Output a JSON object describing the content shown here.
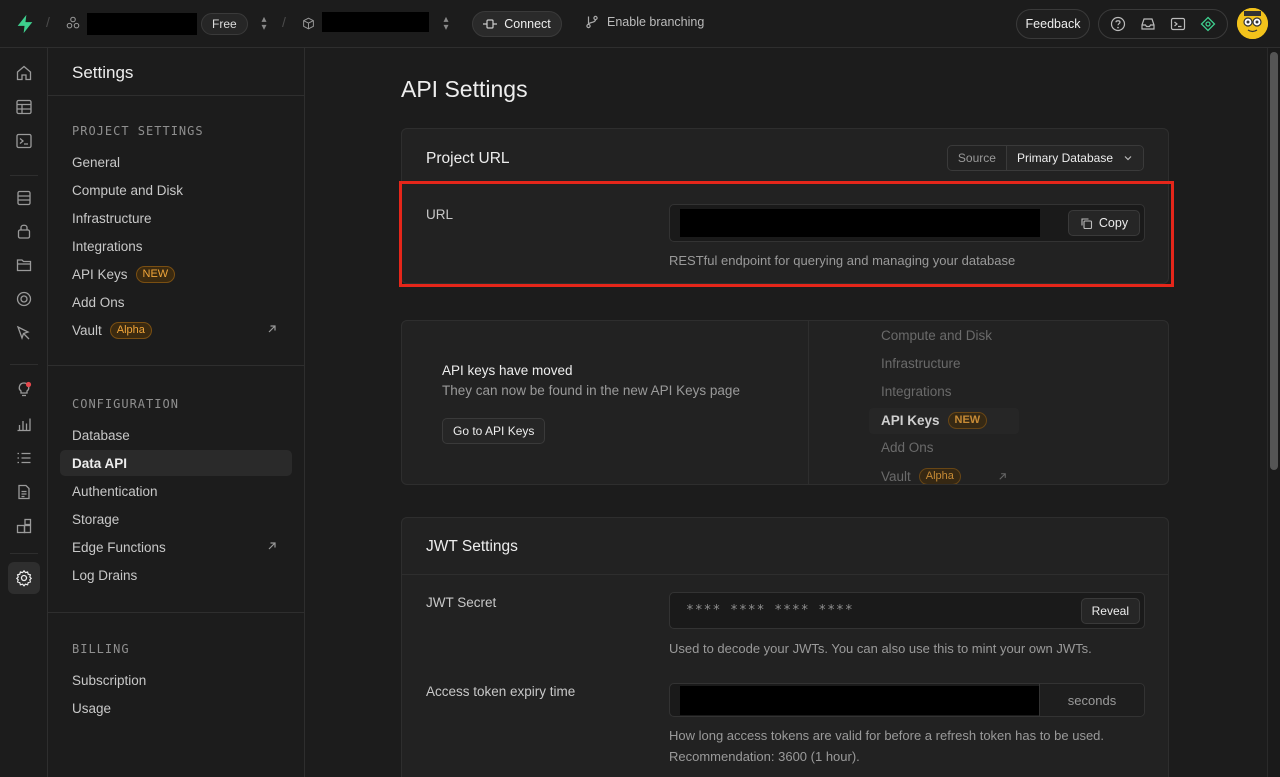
{
  "topbar": {
    "plan_badge": "Free",
    "connect_label": "Connect",
    "branching_label": "Enable branching",
    "feedback_label": "Feedback"
  },
  "sidebar": {
    "title": "Settings",
    "groups": [
      {
        "heading": "PROJECT SETTINGS",
        "items": [
          {
            "label": "General"
          },
          {
            "label": "Compute and Disk"
          },
          {
            "label": "Infrastructure"
          },
          {
            "label": "Integrations"
          },
          {
            "label": "API Keys",
            "badge": "NEW"
          },
          {
            "label": "Add Ons"
          },
          {
            "label": "Vault",
            "badge": "Alpha",
            "external": true
          }
        ]
      },
      {
        "heading": "CONFIGURATION",
        "items": [
          {
            "label": "Database"
          },
          {
            "label": "Data API",
            "active": true
          },
          {
            "label": "Authentication"
          },
          {
            "label": "Storage"
          },
          {
            "label": "Edge Functions",
            "external": true
          },
          {
            "label": "Log Drains"
          }
        ]
      },
      {
        "heading": "BILLING",
        "items": [
          {
            "label": "Subscription"
          },
          {
            "label": "Usage"
          }
        ]
      }
    ]
  },
  "main": {
    "title": "API Settings",
    "project_url": {
      "heading": "Project URL",
      "source_label": "Source",
      "source_value": "Primary Database",
      "url_label": "URL",
      "copy_label": "Copy",
      "hint": "RESTful endpoint for querying and managing your database"
    },
    "moved": {
      "title": "API keys have moved",
      "subtitle": "They can now be found in the new API Keys page",
      "button": "Go to API Keys",
      "preview_items": [
        {
          "label": "Compute and Disk"
        },
        {
          "label": "Infrastructure"
        },
        {
          "label": "Integrations"
        },
        {
          "label": "API Keys",
          "badge": "NEW",
          "active": true
        },
        {
          "label": "Add Ons"
        },
        {
          "label": "Vault",
          "badge": "Alpha"
        }
      ]
    },
    "jwt": {
      "heading": "JWT Settings",
      "secret_label": "JWT Secret",
      "secret_masked": "**** **** **** ****",
      "reveal_label": "Reveal",
      "secret_hint": "Used to decode your JWTs. You can also use this to mint your own JWTs.",
      "expiry_label": "Access token expiry time",
      "expiry_unit": "seconds",
      "expiry_hint_1": "How long access tokens are valid for before a refresh token has to be used.",
      "expiry_hint_2": "Recommendation: 3600 (1 hour)."
    }
  },
  "colors": {
    "background": "#1c1c1c",
    "brand": "#3ecf8e",
    "highlight": "#e5261a",
    "badge": "#f0a53a"
  }
}
